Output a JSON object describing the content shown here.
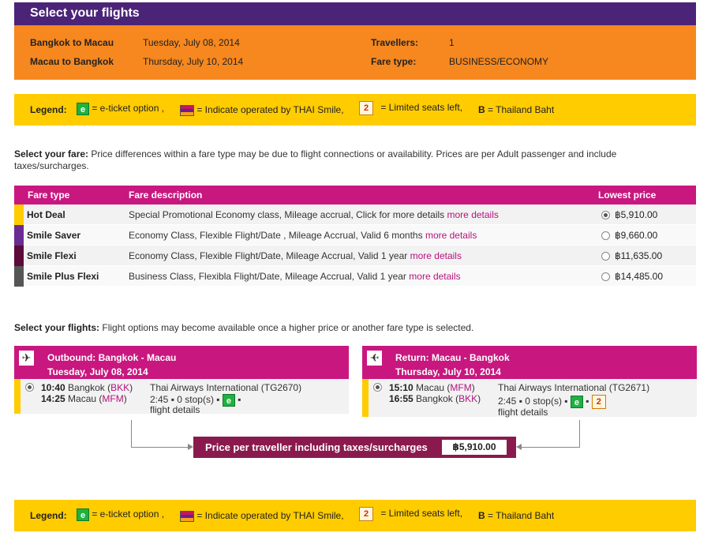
{
  "header": {
    "title": "Select your flights"
  },
  "trip": {
    "leg1_label": "Bangkok to Macau",
    "leg1_date": "Tuesday, July 08, 2014",
    "leg2_label": "Macau to Bangkok",
    "leg2_date": "Thursday, July 10, 2014",
    "travellers_label": "Travellers:",
    "travellers_value": "1",
    "fare_type_label": "Fare type:",
    "fare_type_value": "BUSINESS/ECONOMY"
  },
  "legend": {
    "title": "Legend:",
    "e_badge": "e",
    "eticket_text": "= e-ticket option ,",
    "smile_text": "= Indicate operated by THAI Smile,",
    "seats_badge": "2",
    "seats_text": "= Limited seats left,",
    "baht_symbol": "B",
    "baht_text": "= Thailand Baht"
  },
  "fare_intro": {
    "label": "Select your fare:",
    "text": " Price differences within a fare type may be due to flight connections or availability. Prices are per Adult passenger and include taxes/surcharges."
  },
  "fare_table": {
    "headers": {
      "type": "Fare type",
      "description": "Fare description",
      "price": "Lowest price"
    },
    "rows": [
      {
        "type": "Hot Deal",
        "description": "Special Promotional Economy class, Mileage accrual, Click for more details",
        "link": "more details",
        "price": "฿5,910.00",
        "color": "#ffcc00",
        "selected": true
      },
      {
        "type": "Smile Saver",
        "description": "Economy Class, Flexible Flight/Date , Mileage Accrual, Valid 6 months",
        "link": "more details",
        "price": "฿9,660.00",
        "color": "#6a2c91",
        "selected": false
      },
      {
        "type": "Smile Flexi",
        "description": "Economy Class, Flexible Flight/Date, Mileage Accrual, Valid 1 year",
        "link": "more details",
        "price": "฿11,635.00",
        "color": "#5b0a3a",
        "selected": false
      },
      {
        "type": "Smile Plus Flexi",
        "description": "Business Class, Flexibla Flight/Date, Mileage Accrual, Valid 1 year",
        "link": "more details",
        "price": "฿14,485.00",
        "color": "#555555",
        "selected": false
      }
    ]
  },
  "flight_intro": {
    "label": "Select your flights:",
    "text": " Flight options may become available once a higher price or another fare type is selected."
  },
  "outbound": {
    "icon": "plane-depart-icon",
    "title": "Outbound: Bangkok - Macau",
    "date": "Tuesday, July 08, 2014",
    "dep_time": "10:40",
    "dep_city": "Bangkok",
    "dep_code": "BKK",
    "arr_time": "14:25",
    "arr_city": "Macau",
    "arr_code": "MFM",
    "airline": "Thai Airways International (TG2670)",
    "duration": "2:45",
    "stops": "0 stop(s)",
    "details_link": "flight details"
  },
  "return": {
    "icon": "plane-arrive-icon",
    "title": "Return: Macau - Bangkok",
    "date": "Thursday, July 10, 2014",
    "dep_time": "15:10",
    "dep_city": "Macau",
    "dep_code": "MFM",
    "arr_time": "16:55",
    "arr_city": "Bangkok",
    "arr_code": "BKK",
    "airline": "Thai Airways International (TG2671)",
    "duration": "2:45",
    "stops": "0 stop(s)",
    "details_link": "flight details"
  },
  "price_summary": {
    "label": "Price per traveller including taxes/surcharges",
    "value": "฿5,910.00"
  }
}
